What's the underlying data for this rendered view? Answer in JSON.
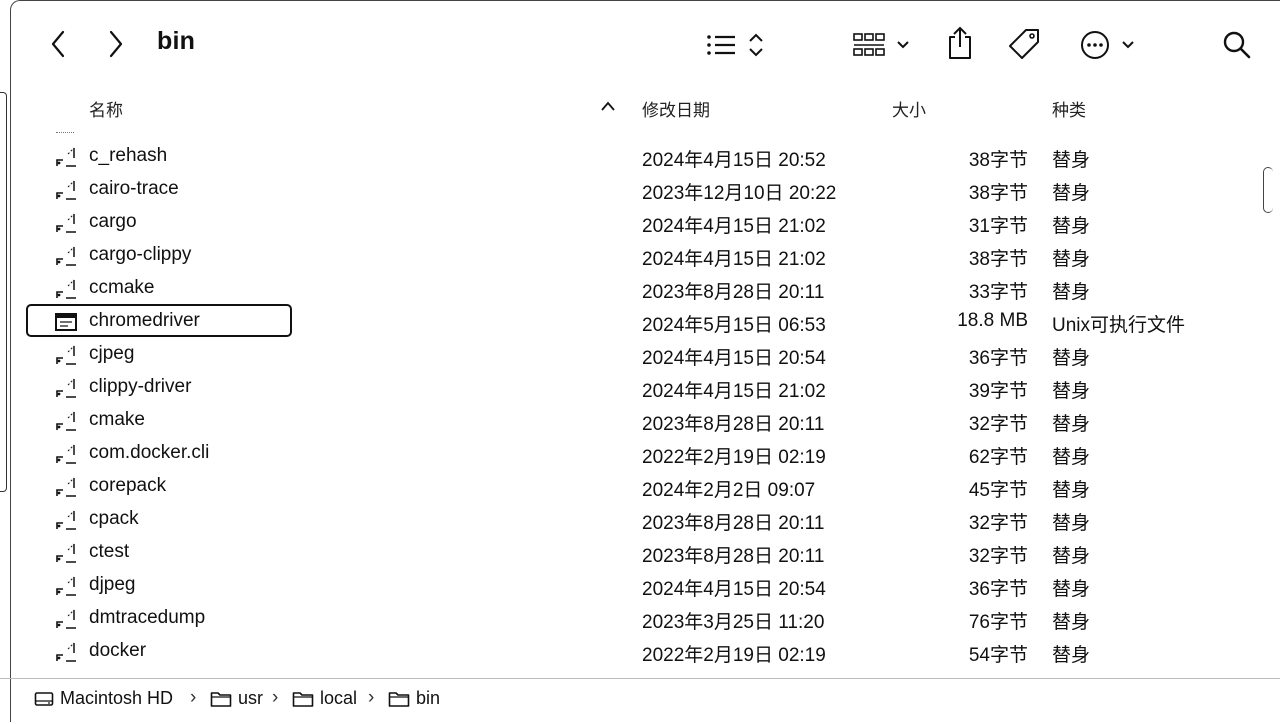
{
  "window": {
    "title": "bin"
  },
  "toolbar": {
    "back_icon": "chevron-left-icon",
    "forward_icon": "chevron-right-icon",
    "view_mode_icon": "list-view-icon",
    "group_icon": "grid-group-icon",
    "share_icon": "share-icon",
    "tag_icon": "tag-icon",
    "more_icon": "ellipsis-circle-icon",
    "search_icon": "search-icon"
  },
  "columns": {
    "name": "名称",
    "modified": "修改日期",
    "size": "大小",
    "kind": "种类"
  },
  "files": [
    {
      "name": "c_rehash",
      "date": "2024年4月15日 20:52",
      "size": "38字节",
      "kind": "替身",
      "type": "alias"
    },
    {
      "name": "cairo-trace",
      "date": "2023年12月10日 20:22",
      "size": "38字节",
      "kind": "替身",
      "type": "alias"
    },
    {
      "name": "cargo",
      "date": "2024年4月15日 21:02",
      "size": "31字节",
      "kind": "替身",
      "type": "alias"
    },
    {
      "name": "cargo-clippy",
      "date": "2024年4月15日 21:02",
      "size": "38字节",
      "kind": "替身",
      "type": "alias"
    },
    {
      "name": "ccmake",
      "date": "2023年8月28日 20:11",
      "size": "33字节",
      "kind": "替身",
      "type": "alias"
    },
    {
      "name": "chromedriver",
      "date": "2024年5月15日 06:53",
      "size": "18.8 MB",
      "kind": "Unix可执行文件",
      "type": "exec",
      "selected": true
    },
    {
      "name": "cjpeg",
      "date": "2024年4月15日 20:54",
      "size": "36字节",
      "kind": "替身",
      "type": "alias"
    },
    {
      "name": "clippy-driver",
      "date": "2024年4月15日 21:02",
      "size": "39字节",
      "kind": "替身",
      "type": "alias"
    },
    {
      "name": "cmake",
      "date": "2023年8月28日 20:11",
      "size": "32字节",
      "kind": "替身",
      "type": "alias"
    },
    {
      "name": "com.docker.cli",
      "date": "2022年2月19日 02:19",
      "size": "62字节",
      "kind": "替身",
      "type": "alias"
    },
    {
      "name": "corepack",
      "date": "2024年2月2日 09:07",
      "size": "45字节",
      "kind": "替身",
      "type": "alias"
    },
    {
      "name": "cpack",
      "date": "2023年8月28日 20:11",
      "size": "32字节",
      "kind": "替身",
      "type": "alias"
    },
    {
      "name": "ctest",
      "date": "2023年8月28日 20:11",
      "size": "32字节",
      "kind": "替身",
      "type": "alias"
    },
    {
      "name": "djpeg",
      "date": "2024年4月15日 20:54",
      "size": "36字节",
      "kind": "替身",
      "type": "alias"
    },
    {
      "name": "dmtracedump",
      "date": "2023年3月25日 11:20",
      "size": "76字节",
      "kind": "替身",
      "type": "alias"
    },
    {
      "name": "docker",
      "date": "2022年2月19日 02:19",
      "size": "54字节",
      "kind": "替身",
      "type": "alias"
    }
  ],
  "path": [
    "Macintosh HD",
    "usr",
    "local",
    "bin"
  ],
  "path_separator": "›"
}
